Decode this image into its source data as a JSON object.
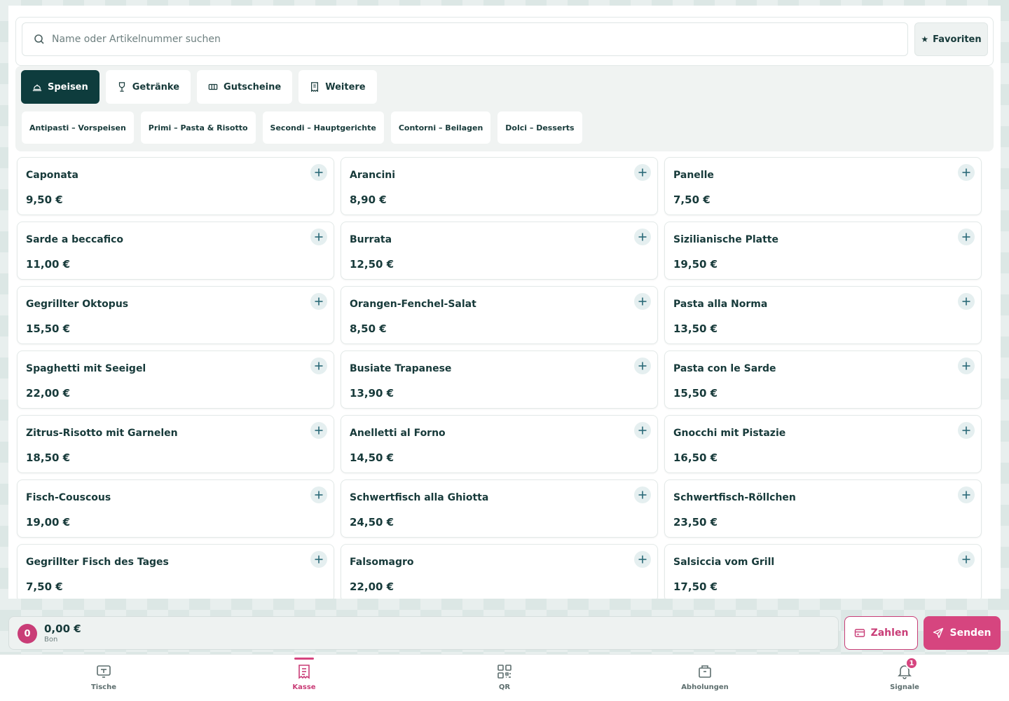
{
  "search": {
    "placeholder": "Name oder Artikelnummer suchen"
  },
  "favorites": {
    "label": "Favoriten"
  },
  "tabs": [
    {
      "label": "Speisen",
      "icon": "cloche-icon",
      "active": true
    },
    {
      "label": "Getränke",
      "icon": "wine-glass-icon",
      "active": false
    },
    {
      "label": "Gutscheine",
      "icon": "ticket-icon",
      "active": false
    },
    {
      "label": "Weitere",
      "icon": "receipt-icon",
      "active": false
    }
  ],
  "subtabs": [
    {
      "label": "Antipasti – Vorspeisen"
    },
    {
      "label": "Primi – Pasta & Risotto"
    },
    {
      "label": "Secondi – Hauptgerichte"
    },
    {
      "label": "Contorni – Beilagen"
    },
    {
      "label": "Dolci – Desserts"
    }
  ],
  "products": [
    {
      "name": "Caponata",
      "price": "9,50 €"
    },
    {
      "name": "Arancini",
      "price": "8,90 €"
    },
    {
      "name": "Panelle",
      "price": "7,50 €"
    },
    {
      "name": "Sarde a beccafico",
      "price": "11,00 €"
    },
    {
      "name": "Burrata",
      "price": "12,50 €"
    },
    {
      "name": "Sizilianische Platte",
      "price": "19,50 €"
    },
    {
      "name": "Gegrillter Oktopus",
      "price": "15,50 €"
    },
    {
      "name": "Orangen-Fenchel-Salat",
      "price": "8,50 €"
    },
    {
      "name": "Pasta alla Norma",
      "price": "13,50 €"
    },
    {
      "name": "Spaghetti mit Seeigel",
      "price": "22,00 €"
    },
    {
      "name": "Busiate Trapanese",
      "price": "13,90 €"
    },
    {
      "name": "Pasta con le Sarde",
      "price": "15,50 €"
    },
    {
      "name": "Zitrus-Risotto mit Garnelen",
      "price": "18,50 €"
    },
    {
      "name": "Anelletti al Forno",
      "price": "14,50 €"
    },
    {
      "name": "Gnocchi mit Pistazie",
      "price": "16,50 €"
    },
    {
      "name": "Fisch-Couscous",
      "price": "19,00 €"
    },
    {
      "name": "Schwertfisch alla Ghiotta",
      "price": "24,50 €"
    },
    {
      "name": "Schwertfisch-Röllchen",
      "price": "23,50 €"
    },
    {
      "name": "Gegrillter Fisch des Tages",
      "price": "7,50 €"
    },
    {
      "name": "Falsomagro",
      "price": "22,00 €"
    },
    {
      "name": "Salsiccia vom Grill",
      "price": "17,50 €"
    }
  ],
  "cart": {
    "count": "0",
    "total": "0,00 €",
    "label": "Bon"
  },
  "actions": {
    "pay": "Zahlen",
    "send": "Senden"
  },
  "nav": [
    {
      "label": "Tische",
      "icon": "table-icon",
      "active": false
    },
    {
      "label": "Kasse",
      "icon": "receipt-icon",
      "active": true
    },
    {
      "label": "QR",
      "icon": "qr-code-icon",
      "active": false
    },
    {
      "label": "Abholungen",
      "icon": "package-icon",
      "active": false
    },
    {
      "label": "Signale",
      "icon": "bell-icon",
      "active": false,
      "badge": "1"
    }
  ],
  "colors": {
    "primary": "#0e3c3d",
    "accent": "#d6457f",
    "text": "#173a3a"
  }
}
